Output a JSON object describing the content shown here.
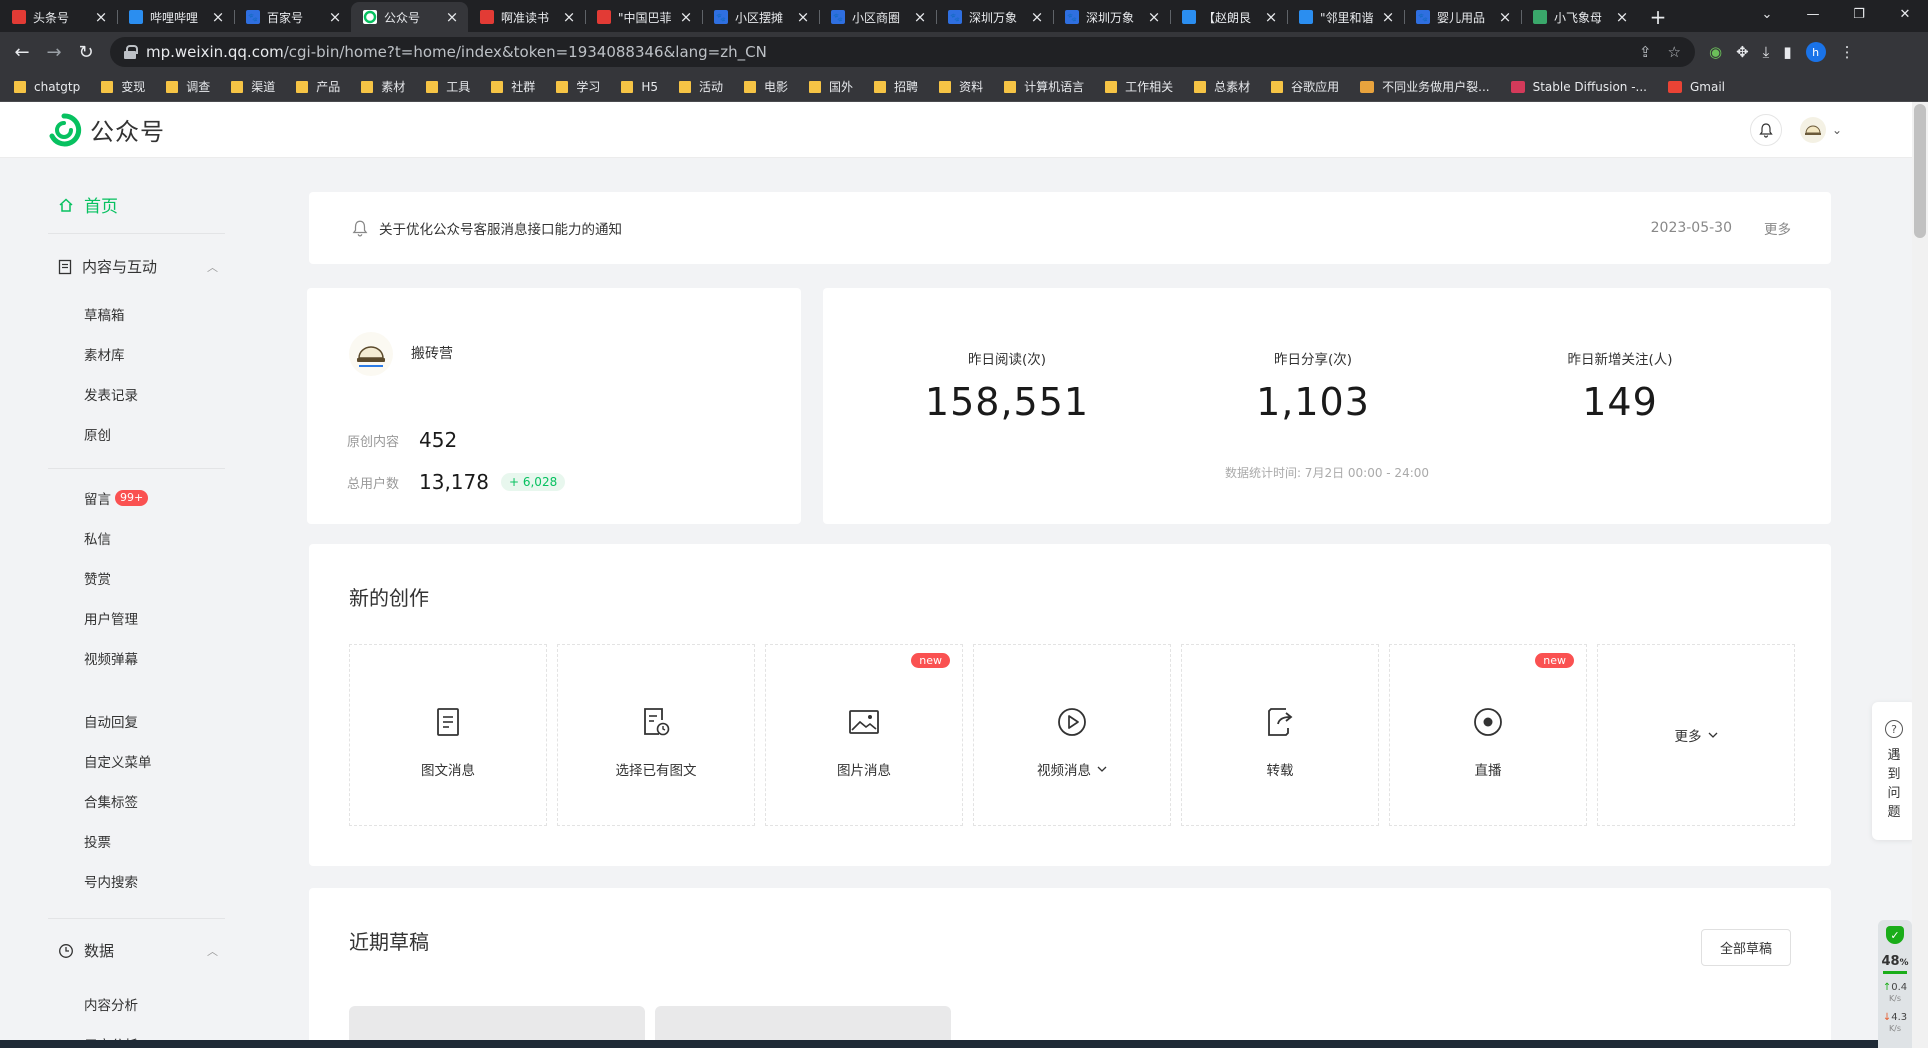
{
  "browser": {
    "tabs": [
      {
        "title": "头条号",
        "favicon": "toutiao-icon",
        "active": false
      },
      {
        "title": "哔哩哔哩",
        "favicon": "bilibili-icon",
        "active": false
      },
      {
        "title": "百家号",
        "favicon": "baidu-paw-icon",
        "active": false
      },
      {
        "title": "公众号",
        "favicon": "wechat-mp-icon",
        "active": true
      },
      {
        "title": "啊准读书",
        "favicon": "toutiao-icon",
        "active": false
      },
      {
        "title": "\"中国巴菲",
        "favicon": "toutiao-icon",
        "active": false
      },
      {
        "title": "小区摆摊",
        "favicon": "baidu-paw-icon",
        "active": false
      },
      {
        "title": "小区商圈",
        "favicon": "baidu-paw-icon",
        "active": false
      },
      {
        "title": "深圳万象",
        "favicon": "baidu-paw-icon",
        "active": false
      },
      {
        "title": "深圳万象",
        "favicon": "baidu-paw-icon",
        "active": false
      },
      {
        "title": "【赵朗艮",
        "favicon": "circle-link-icon",
        "active": false
      },
      {
        "title": "\"邻里和谐",
        "favicon": "circle-link-icon",
        "active": false
      },
      {
        "title": "婴儿用品",
        "favicon": "baidu-paw-icon",
        "active": false
      },
      {
        "title": "小飞象母",
        "favicon": "image-icon",
        "active": false
      }
    ],
    "url_host": "mp.weixin.qq.com",
    "url_path": "/cgi-bin/home?t=home/index&token=1934088346&lang=zh_CN",
    "profile_letter": "h",
    "bookmarks": [
      {
        "label": "chatgtp",
        "type": "folder"
      },
      {
        "label": "变现",
        "type": "folder"
      },
      {
        "label": "调查",
        "type": "folder"
      },
      {
        "label": "渠道",
        "type": "folder"
      },
      {
        "label": "产品",
        "type": "folder"
      },
      {
        "label": "素材",
        "type": "folder"
      },
      {
        "label": "工具",
        "type": "folder"
      },
      {
        "label": "社群",
        "type": "folder"
      },
      {
        "label": "学习",
        "type": "folder"
      },
      {
        "label": "H5",
        "type": "folder"
      },
      {
        "label": "活动",
        "type": "folder"
      },
      {
        "label": "电影",
        "type": "folder"
      },
      {
        "label": "国外",
        "type": "folder"
      },
      {
        "label": "招聘",
        "type": "folder"
      },
      {
        "label": "资料",
        "type": "folder"
      },
      {
        "label": "计算机语言",
        "type": "folder"
      },
      {
        "label": "工作相关",
        "type": "folder"
      },
      {
        "label": "总素材",
        "type": "folder"
      },
      {
        "label": "谷歌应用",
        "type": "folder"
      },
      {
        "label": "不同业务做用户裂...",
        "type": "site",
        "color": "#e8a33d"
      },
      {
        "label": "Stable Diffusion -...",
        "type": "site",
        "color": "#d43a5a"
      },
      {
        "label": "Gmail",
        "type": "site",
        "color": "#ea4335"
      }
    ]
  },
  "header": {
    "brand": "公众号",
    "brand_color": "#07c160"
  },
  "sidebar": {
    "home": "首页",
    "content_group": "内容与互动",
    "content_items": [
      "草稿箱",
      "素材库",
      "发表记录",
      "原创"
    ],
    "interact_items": [
      {
        "label": "留言",
        "badge": "99+"
      },
      {
        "label": "私信"
      },
      {
        "label": "赞赏"
      },
      {
        "label": "用户管理"
      },
      {
        "label": "视频弹幕"
      }
    ],
    "tool_items": [
      "自动回复",
      "自定义菜单",
      "合集标签",
      "投票",
      "号内搜索"
    ],
    "data_group": "数据",
    "data_items": [
      "内容分析",
      "用户分析"
    ]
  },
  "notice": {
    "text": "关于优化公众号客服消息接口能力的通知",
    "date": "2023-05-30",
    "more": "更多"
  },
  "account": {
    "name": "搬砖营",
    "original_label": "原创内容",
    "original_value": "452",
    "users_label": "总用户数",
    "users_value": "13,178",
    "users_delta": "+ 6,028"
  },
  "stats": {
    "items": [
      {
        "label": "昨日阅读(次)",
        "value": "158,551"
      },
      {
        "label": "昨日分享(次)",
        "value": "1,103"
      },
      {
        "label": "昨日新增关注(人)",
        "value": "149"
      }
    ],
    "note": "数据统计时间: 7月2日 00:00 - 24:00"
  },
  "create": {
    "title": "新的创作",
    "tiles": [
      {
        "label": "图文消息",
        "icon": "document-icon",
        "new": false
      },
      {
        "label": "选择已有图文",
        "icon": "document-clock-icon",
        "new": false
      },
      {
        "label": "图片消息",
        "icon": "image-icon",
        "new": true
      },
      {
        "label": "视频消息",
        "icon": "play-circle-icon",
        "new": false,
        "dropdown": true
      },
      {
        "label": "转载",
        "icon": "share-icon",
        "new": false
      },
      {
        "label": "直播",
        "icon": "live-icon",
        "new": true
      },
      {
        "label": "更多",
        "icon": "",
        "new": false,
        "dropdown": true
      }
    ],
    "new_badge": "new"
  },
  "drafts": {
    "title": "近期草稿",
    "all_button": "全部草稿"
  },
  "help": {
    "chars": [
      "遇",
      "到",
      "问",
      "题"
    ]
  },
  "net_widget": {
    "percent": "48",
    "unit": "%",
    "up": "0.4",
    "up_unit": "K/s",
    "down": "4.3",
    "down_unit": "K/s"
  }
}
